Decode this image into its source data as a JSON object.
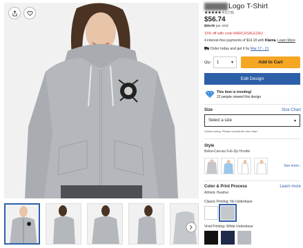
{
  "product": {
    "title": "Logo T-Shirt",
    "rating_stars": "★★★★★",
    "rating_text": "4.6 (78)",
    "price": "$56.74",
    "old_price": "$66.75",
    "old_price_suffix": "per shirt",
    "promo": "15% off with code MARCHSALEZAU",
    "klarna_text": "4 interest-free payments of $14.18 with",
    "klarna_brand": "Klarna.",
    "klarna_link": "Learn More",
    "delivery_text": "Order today and get it by",
    "delivery_date": "Mar 17 - 21"
  },
  "purchase": {
    "qty_label": "Qty:",
    "qty_value": "1",
    "add_to_cart": "Add to Cart",
    "edit_design": "Edit Design"
  },
  "trending": {
    "line1": "This item is trending!",
    "line2": "22 people viewed this design"
  },
  "size": {
    "label": "Size",
    "chart_link": "Size Chart",
    "placeholder": "Select a size",
    "note": "Unisex sizing. Please consult the size chart."
  },
  "style": {
    "label": "Style",
    "value": "Bella+Canvas Full-Zip Hoodie",
    "see_more": "See more ›"
  },
  "color_print": {
    "label": "Color & Print Process",
    "learn_more": "Learn more",
    "value": "Athletic Heather",
    "classic_label": "Classic Printing: No Underbase",
    "vivid_label": "Vivid Printing: White Underbase",
    "colors": {
      "white": "#ffffff",
      "heather": "#c4c7cb",
      "black": "#111111",
      "navy": "#1f2a4a",
      "heather2": "#b8bcc0"
    }
  },
  "icons": {
    "share": "share-icon",
    "favorite": "heart-icon",
    "caret": "caret-down-icon",
    "trending": "diamond-icon"
  }
}
